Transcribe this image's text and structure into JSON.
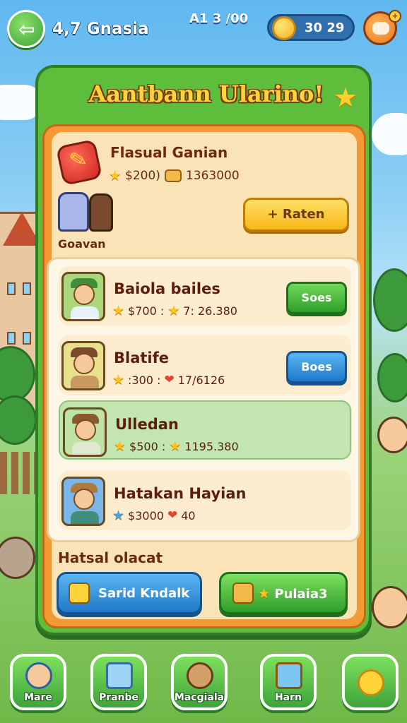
{
  "header": {
    "player_name": "4,7 Gnasia",
    "stat": "A1 3  /00",
    "coins": "30  29",
    "notify": "+"
  },
  "panel": {
    "title": "Aantbann Ularino!"
  },
  "featured": {
    "title": "Flasual Ganian",
    "price": "$200)",
    "amount": "1363000",
    "friends_label": "Goavan",
    "rate_button": "Raten",
    "rate_icon": "+"
  },
  "list": [
    {
      "name": "Baiola bailes",
      "price": "$700 :",
      "amount": "7: 26.380",
      "button": "Soes",
      "button_color": "green",
      "highlighted": false
    },
    {
      "name": "Blatife",
      "price": ":300 :",
      "amount": "17/6126",
      "button": "Boes",
      "button_color": "blue",
      "highlighted": false
    },
    {
      "name": "Ulledan",
      "price": "$500 :",
      "amount": "1195.380",
      "button": "",
      "button_color": "",
      "highlighted": true
    },
    {
      "name": "Hatakan Hayian",
      "price": "$3000",
      "amount": "40",
      "button": "",
      "button_color": "",
      "highlighted": false
    }
  ],
  "section": {
    "label": "Hatsal olacat",
    "left_button": "Sarid Kndalk",
    "right_button": "Pulaia3"
  },
  "nav": [
    {
      "label": "Mare",
      "icon": "avatar-icon"
    },
    {
      "label": "Pranbe",
      "icon": "cube-icon"
    },
    {
      "label": "Macgiala",
      "icon": "mascot-icon"
    },
    {
      "label": "Harn",
      "icon": "chest-icon"
    },
    {
      "label": "",
      "icon": "smiley-icon"
    }
  ],
  "colors": {
    "panel_green": "#5fbd3c",
    "panel_orange": "#f39a34",
    "title_yellow": "#ffd43b",
    "button_green": "#2f9e2a",
    "button_blue": "#1f79c9"
  }
}
